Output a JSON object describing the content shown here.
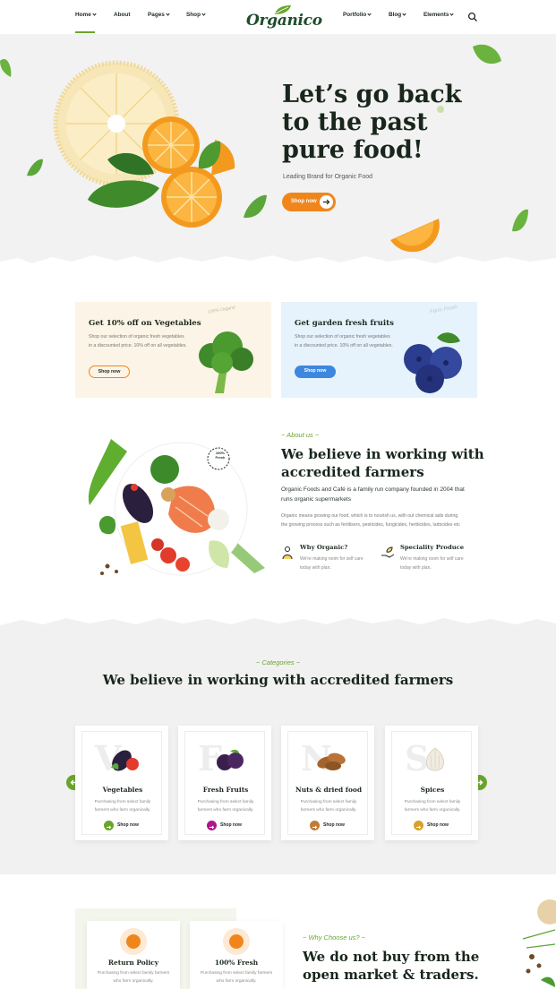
{
  "brand": {
    "logo_text": "Organico",
    "accent": "#6aa52b",
    "orange": "#f0861b",
    "dark": "#18261b"
  },
  "nav": {
    "left": [
      {
        "label": "Home",
        "has_caret": true,
        "active": true
      },
      {
        "label": "About",
        "has_caret": false
      },
      {
        "label": "Pages",
        "has_caret": true
      },
      {
        "label": "Shop",
        "has_caret": true
      }
    ],
    "right": [
      {
        "label": "Portfolio",
        "has_caret": true
      },
      {
        "label": "Blog",
        "has_caret": true
      },
      {
        "label": "Elements",
        "has_caret": true
      }
    ],
    "search_icon": "search-icon"
  },
  "hero": {
    "title": "Let’s go back to the past pure food!",
    "subtitle": "Leading Brand for Organic Food",
    "button_label": "Shop now"
  },
  "promos": [
    {
      "title": "Get 10% off on Vegetables",
      "description": "Shop our selection of organic fresh vegetables in a discounted price. 10% off on all vegetables.",
      "button_label": "Shop now",
      "background": "#fcf4e6",
      "button_style": "outline-orange",
      "stamp_text": "100% Organic"
    },
    {
      "title": "Get garden fresh fruits",
      "description": "Shop our selection of organic fresh vegetables in a discounted price. 10% off on all vegetables.",
      "button_label": "Shop now",
      "background": "#e6f3fc",
      "button_style": "solid-blue",
      "stamp_text": "Farm Fresh"
    }
  ],
  "about": {
    "tag": "~ About us ~",
    "title": "We believe in working with accredited farmers",
    "lead": "Organic Foods and Café is a family run company founded in 2004 that runs organic supermarkets",
    "body": "Organic means growing our food, which is to nourish us, with out chemical aids during the growing process such as fertilisers, pesticides, fungicides, herbicides, larbicides etc",
    "badge": "100% Fresh",
    "features": [
      {
        "title": "Why Organic?",
        "description": "We're making room for self care today with plan.",
        "icon": "leaf-person-icon"
      },
      {
        "title": "Speciality Produce",
        "description": "We're making room for self care today with plan.",
        "icon": "hand-leaf-icon"
      }
    ]
  },
  "categories": {
    "tag": "~ Categories ~",
    "title": "We believe in working with accredited farmers",
    "items": [
      {
        "letter": "V",
        "title": "Vegetables",
        "description": "Purchasing from select family farmers who farm organically.",
        "shop_label": "Shop now",
        "dot_color": "#6aa52b",
        "icon": "vegetables-icon"
      },
      {
        "letter": "F",
        "title": "Fresh Fruits",
        "description": "Purchasing from select family farmers who farm organically.",
        "shop_label": "Shop now",
        "dot_color": "#b0168a",
        "icon": "plums-icon"
      },
      {
        "letter": "N",
        "title": "Nuts & dried food",
        "description": "Purchasing from select family farmers who farm organically.",
        "shop_label": "Shop now",
        "dot_color": "#c07a3a",
        "icon": "almonds-icon"
      },
      {
        "letter": "S",
        "title": "Spices",
        "description": "Purchasing from select family farmers who farm organically.",
        "shop_label": "Shop now",
        "dot_color": "#d8a02a",
        "icon": "garlic-icon"
      }
    ]
  },
  "why": {
    "tag": "~ Why Choose us? ~",
    "title": "We do not buy from the open market & traders.",
    "cards": [
      {
        "title": "Return Policy",
        "description": "Purchasing from select family farmers who farm organically.",
        "icon": "return-icon"
      },
      {
        "title": "100% Fresh",
        "description": "Purchasing from select family farmers who farm organically.",
        "icon": "leaf-icon"
      }
    ]
  }
}
